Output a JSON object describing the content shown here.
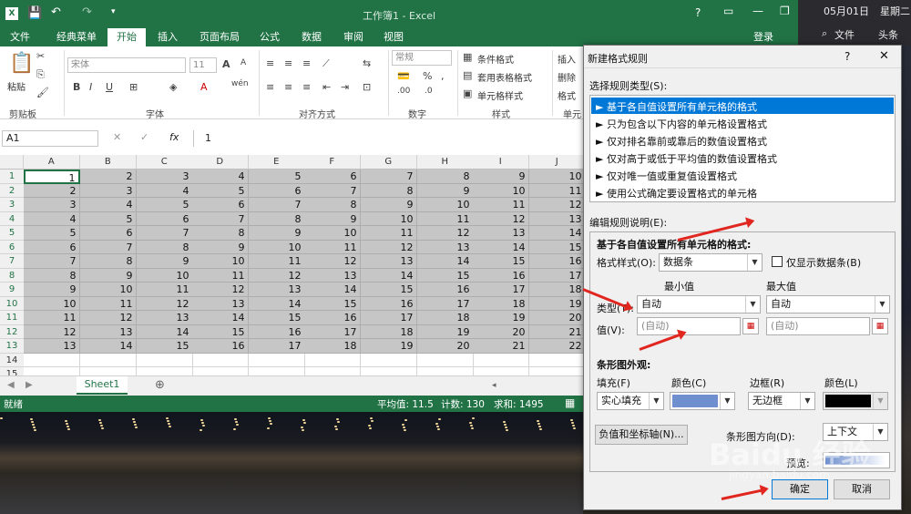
{
  "window_title": "工作簿1 - Excel",
  "quick_access": {
    "file_icon": "excel-icon"
  },
  "ribbon_tabs": [
    "文件",
    "经典菜单",
    "开始",
    "插入",
    "页面布局",
    "公式",
    "数据",
    "审阅",
    "视图"
  ],
  "login_label": "登录",
  "sysbar": {
    "date": "05月01日",
    "weekday": "星期二",
    "file_label": "文件",
    "headline_label": "头条"
  },
  "ribbon": {
    "paste_label": "粘贴",
    "clipboard_group": "剪贴板",
    "font_box": "宋体",
    "size_box": "11",
    "font_group": "字体",
    "align_group": "对齐方式",
    "number_box": "常规",
    "number_group": "数字",
    "cond_format": "条件格式",
    "table_format": "套用表格格式",
    "cell_style": "单元格样式",
    "style_group": "样式",
    "insert_label": "插入",
    "delete_label": "删除",
    "format_label": "格式",
    "cells_group": "单元"
  },
  "formula": {
    "name_box": "A1",
    "fx": "fx",
    "value": "1"
  },
  "columns": [
    "A",
    "B",
    "C",
    "D",
    "E",
    "F",
    "G",
    "H",
    "I",
    "J"
  ],
  "rows": [
    [
      "1",
      "1",
      "2",
      "3",
      "4",
      "5",
      "6",
      "7",
      "8",
      "9",
      "10"
    ],
    [
      "2",
      "2",
      "3",
      "4",
      "5",
      "6",
      "7",
      "8",
      "9",
      "10",
      "11"
    ],
    [
      "3",
      "3",
      "4",
      "5",
      "6",
      "7",
      "8",
      "9",
      "10",
      "11",
      "12"
    ],
    [
      "4",
      "4",
      "5",
      "6",
      "7",
      "8",
      "9",
      "10",
      "11",
      "12",
      "13"
    ],
    [
      "5",
      "5",
      "6",
      "7",
      "8",
      "9",
      "10",
      "11",
      "12",
      "13",
      "14"
    ],
    [
      "6",
      "6",
      "7",
      "8",
      "9",
      "10",
      "11",
      "12",
      "13",
      "14",
      "15"
    ],
    [
      "7",
      "7",
      "8",
      "9",
      "10",
      "11",
      "12",
      "13",
      "14",
      "15",
      "16"
    ],
    [
      "8",
      "8",
      "9",
      "10",
      "11",
      "12",
      "13",
      "14",
      "15",
      "16",
      "17"
    ],
    [
      "9",
      "9",
      "10",
      "11",
      "12",
      "13",
      "14",
      "15",
      "16",
      "17",
      "18"
    ],
    [
      "10",
      "10",
      "11",
      "12",
      "13",
      "14",
      "15",
      "16",
      "17",
      "18",
      "19"
    ],
    [
      "11",
      "11",
      "12",
      "13",
      "14",
      "15",
      "16",
      "17",
      "18",
      "19",
      "20"
    ],
    [
      "12",
      "12",
      "13",
      "14",
      "15",
      "16",
      "17",
      "18",
      "19",
      "20",
      "21"
    ],
    [
      "13",
      "13",
      "14",
      "15",
      "16",
      "17",
      "18",
      "19",
      "20",
      "21",
      "22"
    ],
    [
      "14",
      "",
      "",
      "",
      "",
      "",
      "",
      "",
      "",
      "",
      ""
    ],
    [
      "15",
      "",
      "",
      "",
      "",
      "",
      "",
      "",
      "",
      "",
      ""
    ]
  ],
  "sheet_tab": "Sheet1",
  "status": {
    "ready": "就绪",
    "avg": "平均值: 11.5",
    "count": "计数: 130",
    "sum": "求和: 1495"
  },
  "dialog": {
    "title": "新建格式规则",
    "help": "?",
    "select_type_label": "选择规则类型(S):",
    "rule_types": [
      "► 基于各自值设置所有单元格的格式",
      "► 只为包含以下内容的单元格设置格式",
      "► 仅对排名靠前或靠后的数值设置格式",
      "► 仅对高于或低于平均值的数值设置格式",
      "► 仅对唯一值或重复值设置格式",
      "► 使用公式确定要设置格式的单元格"
    ],
    "edit_label": "编辑规则说明(E):",
    "desc_title": "基于各自值设置所有单元格的格式:",
    "style_label": "格式样式(O):",
    "style_value": "数据条",
    "show_bar_only": "仅显示数据条(B)",
    "min_label": "最小值",
    "max_label": "最大值",
    "type_label": "类型(T):",
    "min_type": "自动",
    "max_type": "自动",
    "value_label": "值(V):",
    "min_value_ph": "(自动)",
    "max_value_ph": "(自动)",
    "bar_appearance": "条形图外观:",
    "fill_label": "填充(F)",
    "color_label": "颜色(C)",
    "border_label": "边框(R)",
    "border_color_label": "颜色(L)",
    "fill_value": "实心填充",
    "border_value": "无边框",
    "fill_color": "#6f8fce",
    "border_color": "#000000",
    "neg_axis_btn": "负值和坐标轴(N)...",
    "direction_label": "条形图方向(D):",
    "direction_value": "上下文",
    "preview_label": "预览:",
    "ok": "确定",
    "cancel": "取消"
  },
  "watermark": "Baidu 经验",
  "watermark_url": "jingyan.baidu.com"
}
